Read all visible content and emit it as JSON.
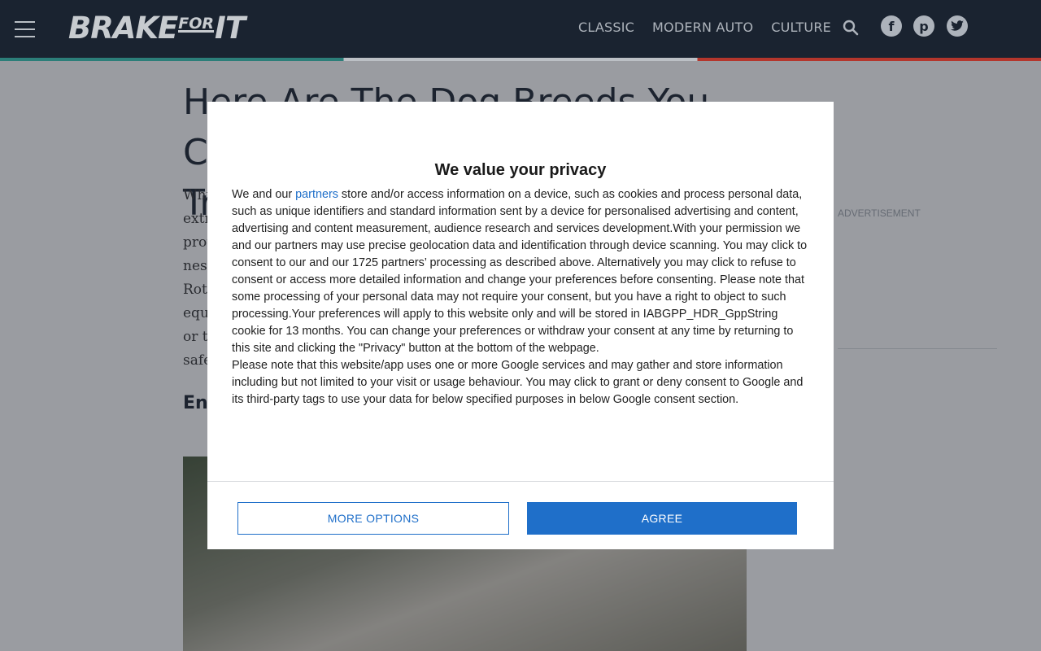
{
  "header": {
    "logo_brake": "BRAKE",
    "logo_for": "FOR",
    "logo_it": "IT",
    "nav": [
      "CLASSIC",
      "MODERN AUTO",
      "CULTURE"
    ],
    "icons": {
      "menu": "hamburger-menu-icon",
      "search": "search-icon",
      "facebook": "facebook-icon",
      "pinterest": "pinterest-icon",
      "twitter": "twitter-icon"
    },
    "colors": {
      "background": "#1b2431",
      "accent_left": "#2f8f86",
      "accent_right": "#cf3a2c"
    }
  },
  "article": {
    "title_lines": [
      "Here Are The Dog Breeds You Can",
      "Tr"
    ],
    "body_fragments": [
      "Whi",
      "extr",
      "prot",
      "nes",
      "Rott",
      "equ",
      "or th",
      "safe"
    ],
    "subheading_fragment": "Eng"
  },
  "sidebar": {
    "ad_label": "ADVERTISEMENT"
  },
  "consent": {
    "title": "We value your privacy",
    "p1_before_link": "We and our ",
    "p1_link": "partners",
    "p1_after_link": " store and/or access information on a device, such as cookies and process personal data, such as unique identifiers and standard information sent by a device for personalised advertising and content, advertising and content measurement, audience research and services development.With your permission we and our partners may use precise geolocation data and identification through device scanning. You may click to consent to our and our 1725 partners’ processing as described above. Alternatively you may click to refuse to consent or access more detailed information and change your preferences before consenting. Please note that some processing of your personal data may not require your consent, but you have a right to object to such processing.Your preferences will apply to this website only and will be stored in IABGPP_HDR_GppString cookie for 13 months. You can change your preferences or withdraw your consent at any time by returning to this site and clicking the \"Privacy\" button at the bottom of the webpage.",
    "p2": "Please note that this website/app uses one or more Google services and may gather and store information including but not limited to your visit or usage behaviour. You may click to grant or deny consent to Google and its third-party tags to use your data for below specified purposes in below Google consent section.",
    "more_options_label": "MORE OPTIONS",
    "agree_label": "AGREE",
    "colors": {
      "primary": "#1f6fc9"
    }
  }
}
